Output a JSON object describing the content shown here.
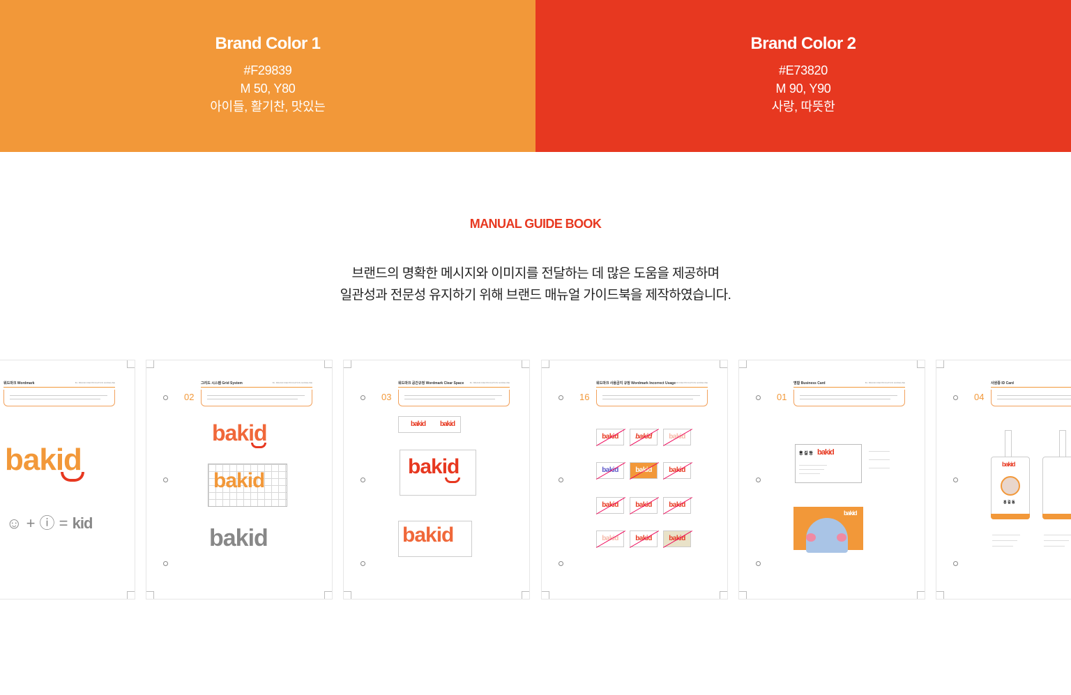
{
  "brand_colors": [
    {
      "title": "Brand Color 1",
      "hex": "#F29839",
      "cmyk": "M 50, Y80",
      "keywords": "아이들, 활기찬, 맛있는"
    },
    {
      "title": "Brand Color 2",
      "hex": "#E73820",
      "cmyk": "M 90, Y90",
      "keywords": "사랑, 따뜻한"
    }
  ],
  "manual": {
    "heading": "MANUAL GUIDE BOOK",
    "desc_line1": "브랜드의 명확한 메시지와 이미지를 전달하는 데 많은 도움을 제공하며",
    "desc_line2": "일관성과 전문성 유지하기 위해 브랜드 매뉴얼 가이드북을 제작하였습니다."
  },
  "pages": [
    {
      "num": "",
      "title": "워드마크 Wordmark",
      "logo": "bakid"
    },
    {
      "num": "02",
      "title": "그리드 시스템 Grid System",
      "logo": "bakid"
    },
    {
      "num": "03",
      "title": "워드마크 공간규정 Wordmark Clear Space",
      "logo": "bakid"
    },
    {
      "num": "16",
      "title": "워드마크 사용금지 규정 Wordmark Incorrect Usage",
      "logo": "bakid"
    },
    {
      "num": "01",
      "title": "명함 Business Card",
      "logo": "bakid",
      "name": "홍 길 동"
    },
    {
      "num": "04",
      "title": "사원증 ID Card",
      "logo": "bakid",
      "name": "홍 길 동"
    }
  ],
  "colors": {
    "orange": "#F29839",
    "red": "#E73820"
  }
}
